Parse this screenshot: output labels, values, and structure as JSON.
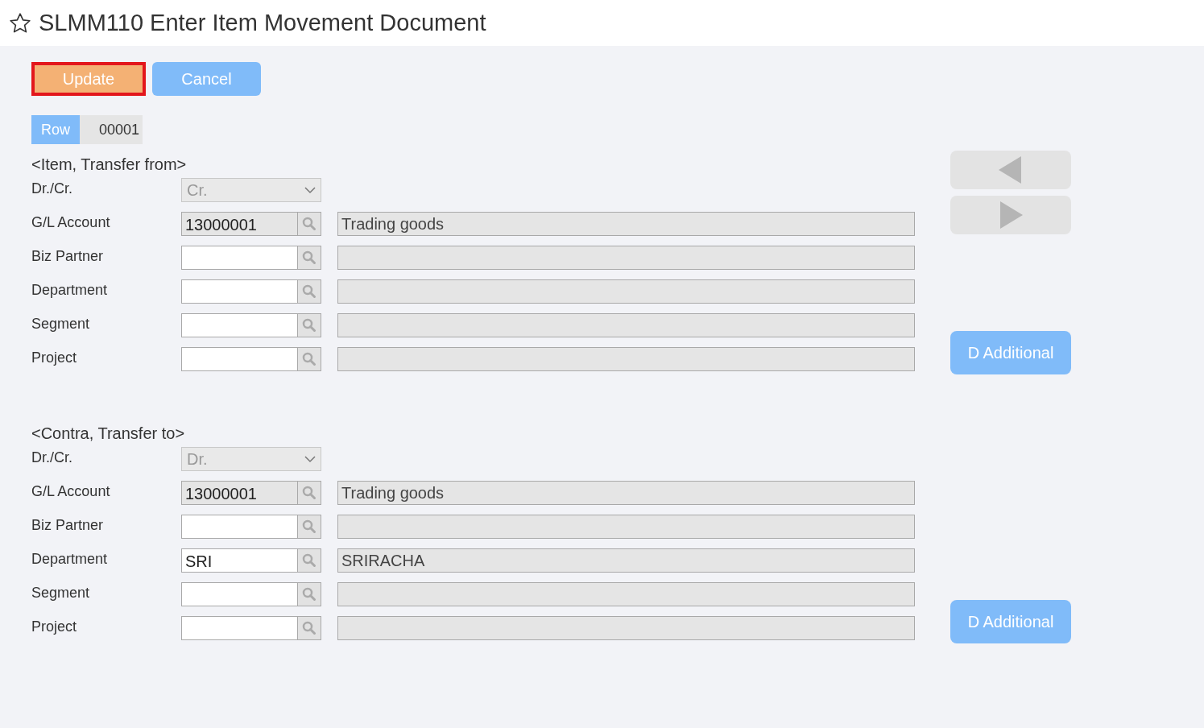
{
  "title": "SLMM110 Enter Item Movement Document",
  "favorite": false,
  "buttons": [
    {
      "label": "Update",
      "kind": "update",
      "highlighted": true
    },
    {
      "label": "Cancel",
      "kind": "cancel",
      "highlighted": false
    }
  ],
  "row": {
    "label": "Row",
    "value": "00001"
  },
  "sections": [
    {
      "heading": "<Item, Transfer from>",
      "drcr": {
        "label": "Dr./Cr.",
        "value": "Cr.",
        "disabled": true
      },
      "fields": [
        {
          "label": "G/L Account",
          "value": "13000001",
          "readonly": true,
          "description": "Trading goods"
        },
        {
          "label": "Biz Partner",
          "readonly": false
        },
        {
          "label": "Department",
          "readonly": false
        },
        {
          "label": "Segment",
          "readonly": false
        },
        {
          "label": "Project",
          "readonly": false
        }
      ],
      "additional_button": "D Additional"
    },
    {
      "heading": "<Contra, Transfer to>",
      "drcr": {
        "label": "Dr./Cr.",
        "value": "Dr.",
        "disabled": true
      },
      "fields": [
        {
          "label": "G/L Account",
          "value": "13000001",
          "readonly": true,
          "description": "Trading goods"
        },
        {
          "label": "Biz Partner",
          "readonly": false
        },
        {
          "label": "Department",
          "value": "SRI",
          "readonly": false,
          "description": "SRIRACHA"
        },
        {
          "label": "Segment",
          "readonly": false
        },
        {
          "label": "Project",
          "readonly": false
        }
      ],
      "additional_button": "D Additional"
    }
  ]
}
